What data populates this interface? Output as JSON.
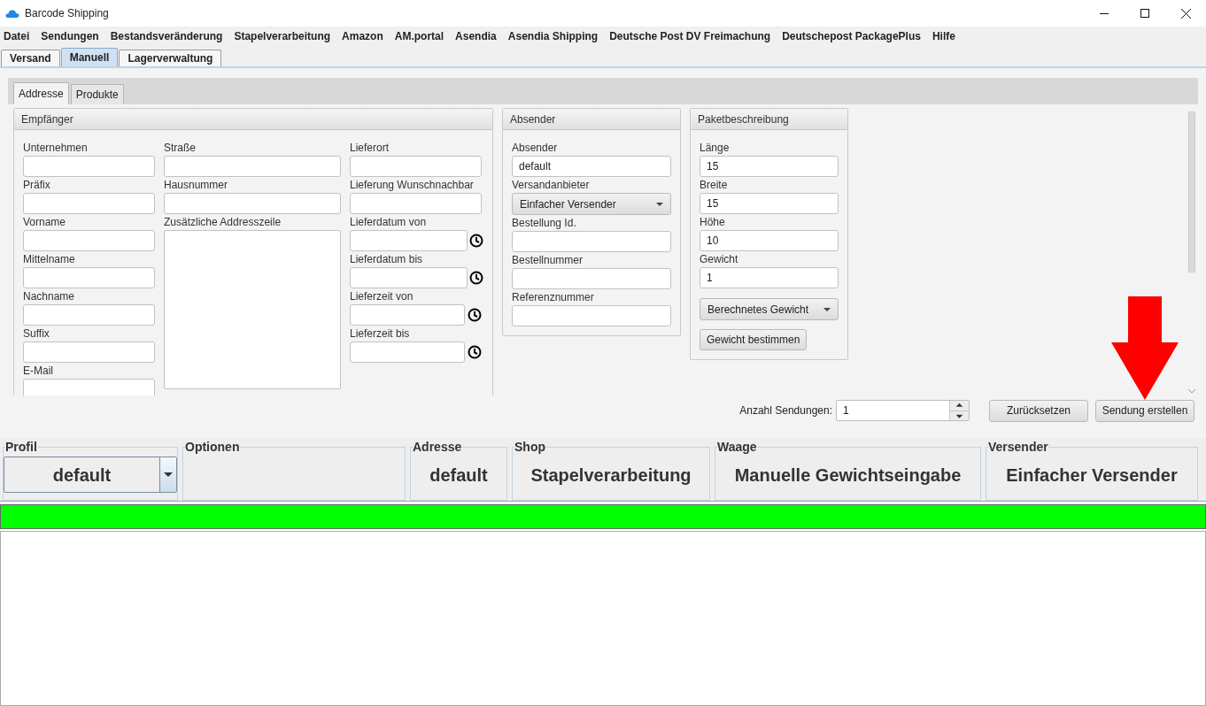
{
  "window": {
    "title": "Barcode Shipping"
  },
  "menu": [
    "Datei",
    "Sendungen",
    "Bestandsveränderung",
    "Stapelverarbeitung",
    "Amazon",
    "AM.portal",
    "Asendia",
    "Asendia Shipping",
    "Deutsche Post DV Freimachung",
    "Deutschepost PackagePlus",
    "Hilfe"
  ],
  "main_tabs": [
    {
      "label": "Versand",
      "selected": false
    },
    {
      "label": "Manuell",
      "selected": true
    },
    {
      "label": "Lagerverwaltung",
      "selected": false
    }
  ],
  "sub_tabs": [
    {
      "label": "Addresse",
      "selected": true
    },
    {
      "label": "Produkte",
      "selected": false
    }
  ],
  "panels": [
    {
      "title": "Empfänger",
      "columns": [
        [
          {
            "kind": "text",
            "label": "Unternehmen"
          },
          {
            "kind": "text",
            "label": "Präfix"
          },
          {
            "kind": "text",
            "label": "Vorname"
          },
          {
            "kind": "text",
            "label": "Mittelname"
          },
          {
            "kind": "text",
            "label": "Nachname"
          },
          {
            "kind": "text",
            "label": "Suffix"
          },
          {
            "kind": "text",
            "label": "E-Mail"
          }
        ],
        [
          {
            "kind": "text",
            "label": "Straße"
          },
          {
            "kind": "text",
            "label": "Hausnummer"
          },
          {
            "kind": "textarea",
            "label": "Zusätzliche Addresszeile"
          }
        ],
        [
          {
            "kind": "text",
            "label": "Lieferort"
          },
          {
            "kind": "text",
            "label": "Lieferung Wunschnachbar"
          },
          {
            "kind": "date",
            "label": "Lieferdatum von"
          },
          {
            "kind": "date",
            "label": "Lieferdatum bis"
          },
          {
            "kind": "time",
            "label": "Lieferzeit von"
          },
          {
            "kind": "time",
            "label": "Lieferzeit bis"
          }
        ]
      ]
    },
    {
      "title": "Absender",
      "columns": [
        [
          {
            "kind": "text",
            "label": "Absender",
            "value": "default"
          },
          {
            "kind": "select",
            "label": "Versandanbieter",
            "value": "Einfacher Versender"
          },
          {
            "kind": "text",
            "label": "Bestellung Id."
          },
          {
            "kind": "text",
            "label": "Bestellnummer"
          },
          {
            "kind": "text",
            "label": "Referenznummer"
          }
        ]
      ]
    },
    {
      "title": "Paketbeschreibung",
      "columns": [
        [
          {
            "kind": "text",
            "label": "Länge",
            "value": "15"
          },
          {
            "kind": "text",
            "label": "Breite",
            "value": "15"
          },
          {
            "kind": "text",
            "label": "Höhe",
            "value": "10"
          },
          {
            "kind": "text",
            "label": "Gewicht",
            "value": "1"
          },
          {
            "kind": "select",
            "value": "Berechnetes Gewicht"
          },
          {
            "kind": "button",
            "value": "Gewicht bestimmen"
          }
        ]
      ]
    }
  ],
  "quantity": {
    "label": "Anzahl Sendungen:",
    "value": "1"
  },
  "buttons": [
    "Zurücksetzen",
    "Sendung erstellen"
  ],
  "status_groups": [
    {
      "title": "Profil",
      "kind": "select",
      "value": "default"
    },
    {
      "title": "Optionen",
      "kind": "empty"
    },
    {
      "title": "Adresse",
      "kind": "value",
      "value": "default"
    },
    {
      "title": "Shop",
      "kind": "value",
      "value": "Stapelverarbeitung"
    },
    {
      "title": "Waage",
      "kind": "value",
      "value": "Manuelle Gewichtseingabe"
    },
    {
      "title": "Versender",
      "kind": "value",
      "value": "Einfacher Versender"
    }
  ]
}
